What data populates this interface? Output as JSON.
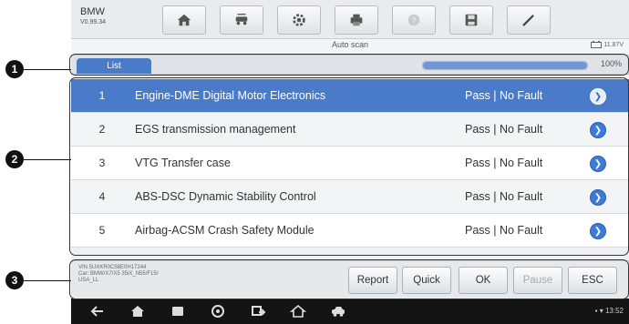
{
  "vehicle": {
    "brand": "BMW",
    "version": "V0.99.34"
  },
  "toolbar": {
    "buttons": [
      {
        "icon": "home-icon"
      },
      {
        "icon": "vehicle-swap-icon"
      },
      {
        "icon": "settings-gear-icon"
      },
      {
        "icon": "print-icon"
      },
      {
        "icon": "help-icon"
      },
      {
        "icon": "save-icon"
      },
      {
        "icon": "pen-icon"
      }
    ]
  },
  "status": {
    "title": "Auto scan",
    "battery": "11.87V"
  },
  "list_tab": {
    "label": "List"
  },
  "progress": {
    "value": 100,
    "label": "100%"
  },
  "systems": [
    {
      "num": "1",
      "name": "Engine-DME Digital Motor Electronics",
      "status": "Pass | No Fault"
    },
    {
      "num": "2",
      "name": "EGS transmission management",
      "status": "Pass | No Fault"
    },
    {
      "num": "3",
      "name": "VTG Transfer case",
      "status": "Pass | No Fault"
    },
    {
      "num": "4",
      "name": "ABS-DSC Dynamic Stability Control",
      "status": "Pass | No Fault"
    },
    {
      "num": "5",
      "name": "Airbag-ACSM Crash Safety Module",
      "status": "Pass | No Fault"
    }
  ],
  "vin_info": {
    "line1": "VIN 5UXKR0C58E0H17244",
    "line2": "Car: BMW/X7/X5 35iX_N55/F15/",
    "line3": "USA_LL"
  },
  "actions": {
    "report": "Report",
    "quick": "Quick",
    "ok": "OK",
    "pause": "Pause",
    "esc": "ESC"
  },
  "clock": "13:52",
  "callouts": [
    "1",
    "2",
    "3"
  ],
  "colors": {
    "accent": "#4a7bc8",
    "arrow": "#3d7bd6"
  }
}
